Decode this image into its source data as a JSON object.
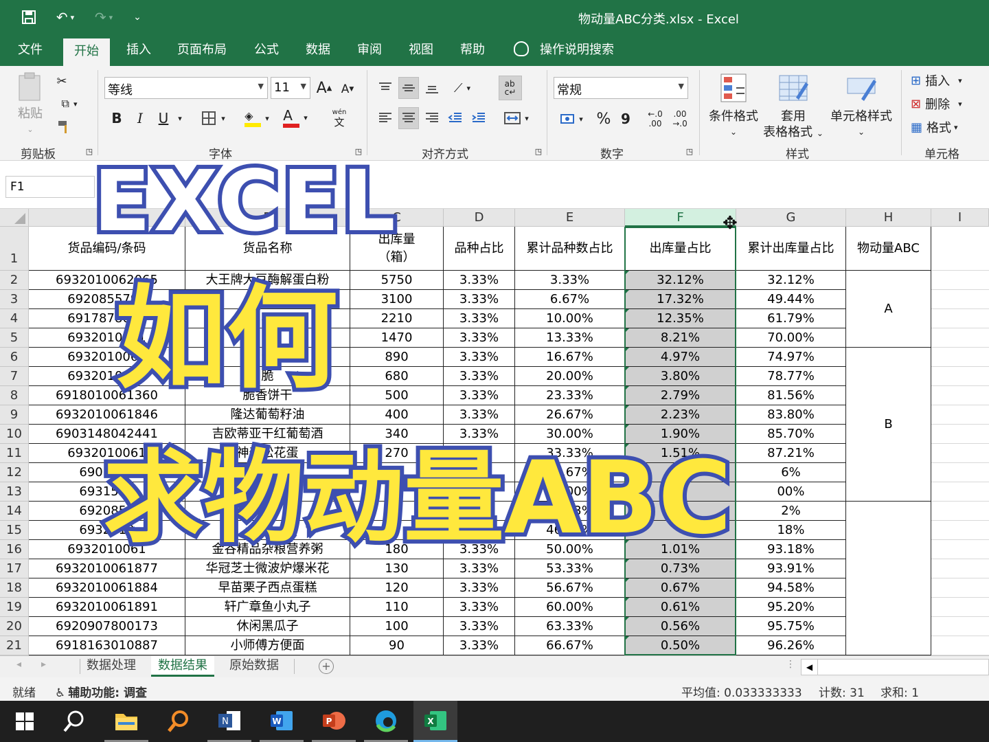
{
  "window": {
    "title": "物动量ABC分类.xlsx  -  Excel"
  },
  "menu": {
    "tabs": [
      "文件",
      "开始",
      "插入",
      "页面布局",
      "公式",
      "数据",
      "审阅",
      "视图",
      "帮助"
    ],
    "tell_me": "操作说明搜索"
  },
  "ribbon": {
    "clipboard": {
      "paste": "粘贴",
      "label": "剪贴板"
    },
    "font": {
      "name": "等线",
      "size": "11",
      "bold": "B",
      "italic": "I",
      "underline": "U",
      "label": "字体",
      "grow": "A",
      "shrink": "A",
      "phonetic_top": "wén",
      "phonetic_bottom": "文"
    },
    "alignment": {
      "label": "对齐方式"
    },
    "number": {
      "format": "常规",
      "label": "数字",
      "percent": "%",
      "comma": "9",
      "inc_top": "←.0",
      "inc_bottom": ".00",
      "dec_top": ".00",
      "dec_bottom": "→.0"
    },
    "styles": {
      "conditional": "条件格式",
      "table_line1": "套用",
      "table_line2": "表格格式",
      "cell_styles": "单元格样式",
      "label": "样式"
    },
    "cells": {
      "insert": "插入",
      "delete": "删除",
      "format": "格式",
      "label": "单元格"
    }
  },
  "formula_bar": {
    "name_box": "F1"
  },
  "sheet": {
    "columns": [
      "A",
      "B",
      "C",
      "D",
      "E",
      "F",
      "G",
      "H",
      "I"
    ],
    "headers": [
      "货品编码/条码",
      "货品名称",
      "出库量\n（箱）",
      "品种占比",
      "累计品种数占比",
      "出库量占比",
      "累计出库量占比",
      "物动量ABC"
    ],
    "row_numbers": [
      "1",
      "2",
      "3",
      "4",
      "5",
      "6",
      "7",
      "8",
      "9",
      "10",
      "11",
      "12",
      "13",
      "14",
      "15",
      "16",
      "17",
      "18",
      "19",
      "20",
      "21"
    ],
    "rows": [
      [
        "6932010062065",
        "大王牌大豆酶解蛋白粉",
        "5750",
        "3.33%",
        "3.33%",
        "32.12%",
        "32.12%"
      ],
      [
        "6920855790",
        "黄",
        "3100",
        "3.33%",
        "6.67%",
        "17.32%",
        "49.44%"
      ],
      [
        "6917878060",
        "石",
        "2210",
        "3.33%",
        "10.00%",
        "12.35%",
        "61.79%"
      ],
      [
        "6932010061",
        "",
        "1470",
        "3.33%",
        "13.33%",
        "8.21%",
        "70.00%"
      ],
      [
        "6932010061",
        "卡",
        "890",
        "3.33%",
        "16.67%",
        "4.97%",
        "74.97%"
      ],
      [
        "6932010061",
        "脆",
        "680",
        "3.33%",
        "20.00%",
        "3.80%",
        "78.77%"
      ],
      [
        "6918010061360",
        "脆香饼干",
        "500",
        "3.33%",
        "23.33%",
        "2.79%",
        "81.56%"
      ],
      [
        "6932010061846",
        "隆达葡萄籽油",
        "400",
        "3.33%",
        "26.67%",
        "2.23%",
        "83.80%"
      ],
      [
        "6903148042441",
        "吉欧蒂亚干红葡萄酒",
        "340",
        "3.33%",
        "30.00%",
        "1.90%",
        "85.70%"
      ],
      [
        "6932010061",
        "神奇松花蛋",
        "270",
        "3.3",
        "33.33%",
        "1.51%",
        "87.21%"
      ],
      [
        "6901521",
        "",
        "",
        "3.",
        "36.67%",
        "",
        "6%"
      ],
      [
        "6931528",
        "",
        "",
        "3.",
        "40.00%",
        "",
        "00%"
      ],
      [
        "6920855",
        "",
        "",
        "3.3",
        "43.33%",
        "",
        "2%"
      ],
      [
        "6932010",
        "纳",
        "",
        "3.3",
        "46.67%",
        "",
        "18%"
      ],
      [
        "6932010061",
        "金谷精品杂粮营养粥",
        "180",
        "3.33%",
        "50.00%",
        "1.01%",
        "93.18%"
      ],
      [
        "6932010061877",
        "华冠芝士微波炉爆米花",
        "130",
        "3.33%",
        "53.33%",
        "0.73%",
        "93.91%"
      ],
      [
        "6932010061884",
        "早苗栗子西点蛋糕",
        "120",
        "3.33%",
        "56.67%",
        "0.67%",
        "94.58%"
      ],
      [
        "6932010061891",
        "轩广章鱼小丸子",
        "110",
        "3.33%",
        "60.00%",
        "0.61%",
        "95.20%"
      ],
      [
        "6920907800173",
        "休闲黑瓜子",
        "100",
        "3.33%",
        "63.33%",
        "0.56%",
        "95.75%"
      ],
      [
        "6918163010887",
        "小师傅方便面",
        "90",
        "3.33%",
        "66.67%",
        "0.50%",
        "96.26%"
      ]
    ],
    "abc_groups": [
      "A",
      "B",
      ""
    ]
  },
  "sheet_tabs": [
    "数据处理",
    "数据结果",
    "原始数据"
  ],
  "status": {
    "ready": "就绪",
    "accessibility": "辅助功能: 调查",
    "average": "平均值: 0.033333333",
    "count": "计数: 31",
    "sum": "求和: 1"
  },
  "overlay": {
    "line1": "EXCEL",
    "line2": "如何",
    "line3": "求物动量ABC"
  },
  "colors": {
    "excel_green": "#217346",
    "overlay_yellow": "#ffe83d",
    "overlay_blue": "#3d4fb0"
  }
}
